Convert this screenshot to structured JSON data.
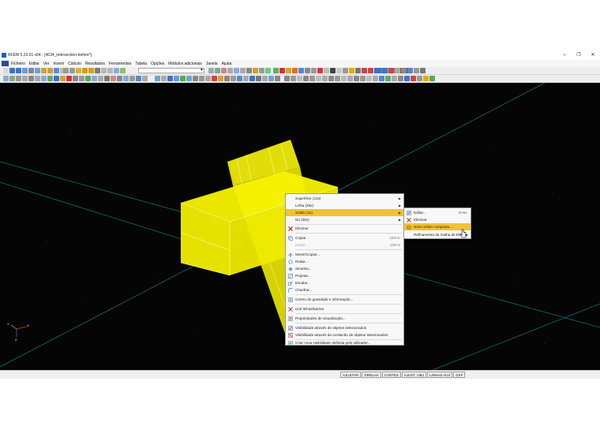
{
  "window": {
    "title": "RFEM 5.23.01 x64 - [4634_intersection-before*]",
    "minimize": "–",
    "maximize": "❐",
    "close": "✕"
  },
  "menubar": {
    "items": [
      "Ficheiro",
      "Editar",
      "Ver",
      "Inserir",
      "Cálculo",
      "Resultados",
      "Ferramentas",
      "Tabela",
      "Opções",
      "Módulos adicionais",
      "Janela",
      "Ajuda"
    ]
  },
  "context_menu": {
    "items": [
      {
        "label": "Superfície (13x)",
        "submenu": true
      },
      {
        "label": "Linha (28x)",
        "submenu": true
      },
      {
        "label": "Sólido (2x)",
        "submenu": true,
        "highlighted": true
      },
      {
        "label": "Nó (28x)",
        "submenu": true
      },
      {
        "label": "Eliminar",
        "icon": "delete-icon"
      },
      {
        "label": "Copiar",
        "shortcut": "Ctrl+C",
        "icon": "copy-icon"
      },
      {
        "label": "Inserir",
        "shortcut": "Ctrl+V",
        "disabled": true
      },
      {
        "label": "Mover/Copiar...",
        "icon": "move-icon"
      },
      {
        "label": "Rodar...",
        "icon": "rotate-icon"
      },
      {
        "label": "Simetria...",
        "icon": "mirror-icon"
      },
      {
        "label": "Projetar...",
        "icon": "project-icon"
      },
      {
        "label": "Escalar...",
        "icon": "scale-icon"
      },
      {
        "label": "Chanfrar...",
        "icon": "chamfer-icon"
      },
      {
        "label": "Centro de gravidade e informação...",
        "icon": "centroid-icon"
      },
      {
        "label": "Unir linhas/barras",
        "icon": "join-icon"
      },
      {
        "label": "Propriedades de visualização...",
        "icon": "display-properties-icon"
      },
      {
        "label": "Visibilidade através de objetos selecionados",
        "icon": "visibility-icon"
      },
      {
        "label": "Visibilidade através da ocultacão de objetos selecionados",
        "icon": "hide-icon"
      },
      {
        "label": "Criar nova visibilidade definida pelo utilizador...",
        "icon": "new-visibility-icon"
      }
    ]
  },
  "submenu": {
    "items": [
      {
        "label": "Editar...",
        "shortcut": "Enter",
        "icon": "edit-icon"
      },
      {
        "label": "Eliminar",
        "icon": "delete-icon"
      },
      {
        "label": "Novo sólido composto...",
        "icon": "new-solid-icon",
        "highlighted": true
      },
      {
        "label": "Refinamento da malha de EF",
        "submenu": true
      }
    ]
  },
  "statusbar": {
    "buttons": [
      "AJUSTAR",
      "GRELHA",
      "CARTES",
      "AJUST. OBJ",
      "LINHAS AUX",
      "DXF"
    ]
  },
  "axes": {
    "x": "X",
    "y": "Y",
    "z": "Z"
  },
  "colors": {
    "solid_yellow": "#f5f00a",
    "highlight": "#f1c232",
    "viewport_bg": "#050505",
    "grid_line": "#0e6f6f"
  }
}
